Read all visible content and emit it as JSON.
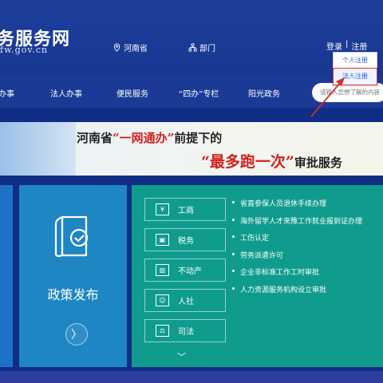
{
  "header": {
    "logo_main": "务服务网",
    "logo_sub": "fw.gov.cn",
    "location": "河南省",
    "department": "部门",
    "login": "登录",
    "separator": "|",
    "register": "注册"
  },
  "register_menu": {
    "items": [
      "个人注册",
      "法人注册"
    ],
    "active_index": 1
  },
  "nav": {
    "items": [
      "办事",
      "法人办事",
      "便民服务",
      "“四办”专栏",
      "阳光政务"
    ]
  },
  "search": {
    "placeholder": "请输入您想了解的内容"
  },
  "banner": {
    "line1_prefix": "河南省",
    "line1_highlight": "“一网通办”",
    "line1_suffix": "前提下的",
    "line2_highlight": "“最多跑一次”",
    "line2_suffix": "审批服务"
  },
  "policy": {
    "title": "政策发布",
    "next": "〉"
  },
  "categories": [
    {
      "label": "工商",
      "icon": "business-icon",
      "glyph": "¥"
    },
    {
      "label": "税务",
      "icon": "wallet-icon",
      "glyph": "▣"
    },
    {
      "label": "不动产",
      "icon": "building-icon",
      "glyph": "▥"
    },
    {
      "label": "人社",
      "icon": "people-icon",
      "glyph": "☺"
    },
    {
      "label": "司法",
      "icon": "gavel-icon",
      "glyph": "⚖"
    }
  ],
  "more": "﹀",
  "services": [
    "省直参保人员退休手续办理",
    "海外留学人才来豫工作就业报到证办理",
    "工伤认定",
    "劳务派遣许可",
    "企业非标准工作工时审批",
    "人力资源服务机构设立审批"
  ],
  "colors": {
    "header": "#1d3f9b",
    "nav": "#1a3a96",
    "policy_tile": "#1f86c4",
    "teal_panel": "#0f9c8d",
    "highlight_red": "#d32020",
    "annotation_arrow": "#d32f2f"
  }
}
